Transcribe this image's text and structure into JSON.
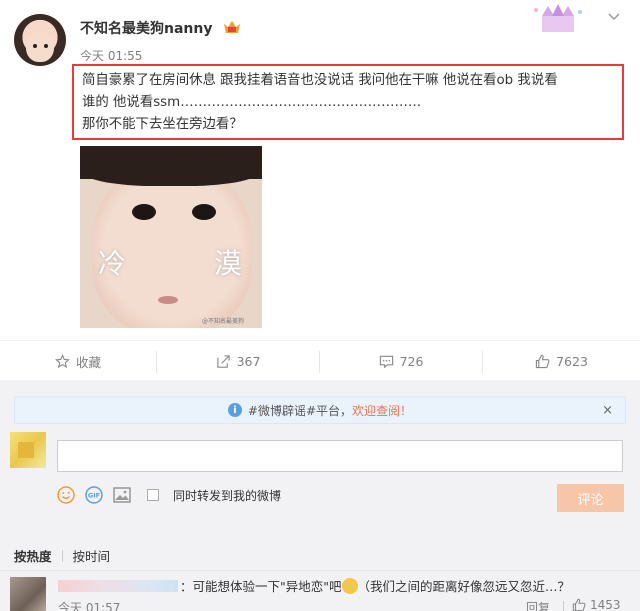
{
  "post": {
    "username": "不知名最美狗nanny",
    "timestamp": "今天 01:55",
    "content_line1": "简自豪累了在房间休息 跟我挂着语音也没说话 我问他在干嘛 他说在看ob 我说看",
    "content_line2": "谁的 他说看ssm………………………………………………",
    "content_line3": "那你不能下去坐在旁边看？",
    "image_text_left": "冷",
    "image_text_right": "漠",
    "image_watermark": "@不知名最美狗"
  },
  "actions": {
    "favorite_label": "收藏",
    "repost_count": "367",
    "comment_count": "726",
    "like_count": "7623"
  },
  "comment_box": {
    "notice_text": "#微博辟谣#平台，",
    "notice_link": "欢迎查阅！",
    "notice_close": "×",
    "input_placeholder": "",
    "forward_label": "同时转发到我的微博",
    "submit_label": "评论"
  },
  "sort": {
    "active": "按热度",
    "other": "按时间"
  },
  "comments": [
    {
      "text_before": "：可能想体验一下\"异地恋\"吧",
      "text_after": "（我们之间的距离好像忽远又忽近…？",
      "time": "今天 01:57",
      "reply_label": "回复",
      "likes": "1453"
    }
  ],
  "colors": {
    "highlight_border": "#e83a3a",
    "link": "#eb7350",
    "submit_disabled": "#f7c6a8"
  }
}
